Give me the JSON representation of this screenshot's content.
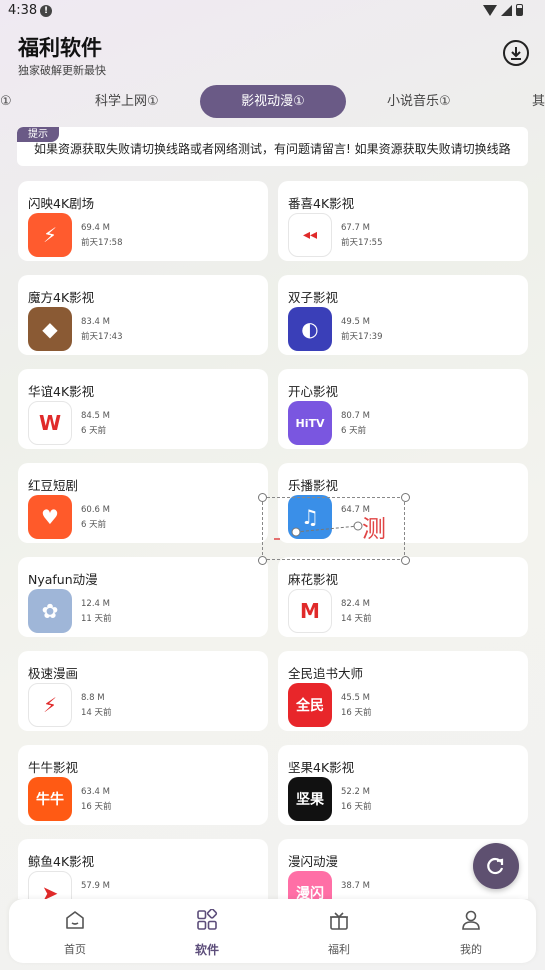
{
  "status": {
    "time": "4:38",
    "notice_glyph": "!"
  },
  "header": {
    "title": "福利软件",
    "subtitle": "独家破解更新最快",
    "download_icon": "download-circle-icon"
  },
  "tabs": [
    {
      "label": "①",
      "active": false
    },
    {
      "label": "科学上网①",
      "active": false
    },
    {
      "label": "影视动漫①",
      "active": true
    },
    {
      "label": "小说音乐①",
      "active": false
    },
    {
      "label": "其",
      "active": false
    }
  ],
  "notice": {
    "tag": "提示",
    "text": "如果资源获取失败请切换线路或者网络测试，有问题请留言!     如果资源获取失败请切换线路"
  },
  "apps": [
    {
      "name": "闪映4K剧场",
      "size": "69.4 M",
      "time": "前天17:58",
      "icon_color": "#ff5b2e",
      "glyph": "⚡"
    },
    {
      "name": "番喜4K影视",
      "size": "67.7 M",
      "time": "前天17:55",
      "icon_color": "#ffffff",
      "glyph": "◂◂"
    },
    {
      "name": "魔方4K影视",
      "size": "83.4 M",
      "time": "前天17:43",
      "icon_color": "#8a5a34",
      "glyph": "◆"
    },
    {
      "name": "双子影视",
      "size": "49.5 M",
      "time": "前天17:39",
      "icon_color": "#3a3fb8",
      "glyph": "◐"
    },
    {
      "name": "华谊4K影视",
      "size": "84.5 M",
      "time": "6 天前",
      "icon_color": "#ffffff",
      "glyph": "W"
    },
    {
      "name": "开心影视",
      "size": "80.7 M",
      "time": "6 天前",
      "icon_color": "#7a56e0",
      "glyph": "HiTV"
    },
    {
      "name": "红豆短剧",
      "size": "60.6 M",
      "time": "6 天前",
      "icon_color": "#ff5a2a",
      "glyph": "♥"
    },
    {
      "name": "乐播影视",
      "size": "64.7 M",
      "time": "",
      "icon_color": "#3a8fe8",
      "glyph": "♫"
    },
    {
      "name": "Nyafun动漫",
      "size": "12.4 M",
      "time": "11 天前",
      "icon_color": "#9fb6d8",
      "glyph": "✿"
    },
    {
      "name": "麻花影视",
      "size": "82.4 M",
      "time": "14 天前",
      "icon_color": "#ffffff",
      "glyph": "M"
    },
    {
      "name": "极速漫画",
      "size": "8.8 M",
      "time": "14 天前",
      "icon_color": "#ffffff",
      "glyph": "⚡"
    },
    {
      "name": "全民追书大师",
      "size": "45.5 M",
      "time": "16 天前",
      "icon_color": "#e8262a",
      "glyph": "全民"
    },
    {
      "name": "牛牛影视",
      "size": "63.4 M",
      "time": "16 天前",
      "icon_color": "#ff5a14",
      "glyph": "牛牛"
    },
    {
      "name": "坚果4K影视",
      "size": "52.2 M",
      "time": "16 天前",
      "icon_color": "#111111",
      "glyph": "坚果"
    },
    {
      "name": "鲸鱼4K影视",
      "size": "57.9 M",
      "time": "",
      "icon_color": "#ffffff",
      "glyph": "➤"
    },
    {
      "name": "漫闪动漫",
      "size": "38.7 M",
      "time": "",
      "icon_color": "#ff6fa6",
      "glyph": "漫闪"
    }
  ],
  "overlay": {
    "text": "测"
  },
  "bottom_nav": [
    {
      "label": "首页",
      "icon": "home-icon",
      "active": false
    },
    {
      "label": "软件",
      "icon": "apps-icon",
      "active": true
    },
    {
      "label": "福利",
      "icon": "gift-icon",
      "active": false
    },
    {
      "label": "我的",
      "icon": "user-icon",
      "active": false
    }
  ],
  "colors": {
    "accent": "#6a5a86",
    "nav_active": "#5c4d7a"
  }
}
